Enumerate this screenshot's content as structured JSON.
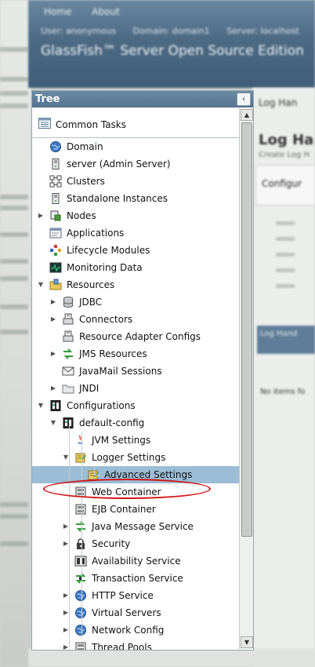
{
  "background": {
    "menu": [
      "Home",
      "About"
    ],
    "user_info": [
      "User: anonymous",
      "Domain: domain1",
      "Server: localhost"
    ],
    "brand": "GlassFish™ Server Open Source Edition",
    "right_tab": "Log Han",
    "right_heading": "Log Han",
    "right_sub": "Create Log H",
    "right_box_label": "Configur",
    "right_bar": "Log Hand",
    "right_no_items": "No items fo"
  },
  "tree": {
    "title": "Tree",
    "collapse_glyph": "‹",
    "common_tasks": "Common Tasks",
    "nodes": [
      {
        "label": "Domain",
        "icon": "globe-icon"
      },
      {
        "label": "server (Admin Server)",
        "icon": "server-icon"
      },
      {
        "label": "Clusters",
        "icon": "clusters-icon"
      },
      {
        "label": "Standalone Instances",
        "icon": "server-icon"
      },
      {
        "label": "Nodes",
        "icon": "nodes-icon"
      },
      {
        "label": "Applications",
        "icon": "applications-icon"
      },
      {
        "label": "Lifecycle Modules",
        "icon": "lifecycle-icon"
      },
      {
        "label": "Monitoring Data",
        "icon": "monitoring-icon"
      },
      {
        "label": "Resources",
        "icon": "resources-icon"
      },
      {
        "label": "JDBC",
        "icon": "database-icon"
      },
      {
        "label": "Connectors",
        "icon": "connector-icon"
      },
      {
        "label": "Resource Adapter Configs",
        "icon": "connector-icon"
      },
      {
        "label": "JMS Resources",
        "icon": "jms-icon"
      },
      {
        "label": "JavaMail Sessions",
        "icon": "mail-icon"
      },
      {
        "label": "JNDI",
        "icon": "folder-icon"
      },
      {
        "label": "Configurations",
        "icon": "config-icon"
      },
      {
        "label": "default-config",
        "icon": "config-icon"
      },
      {
        "label": "JVM Settings",
        "icon": "java-icon"
      },
      {
        "label": "Logger Settings",
        "icon": "logger-icon"
      },
      {
        "label": "Advanced Settings",
        "icon": "logger-icon"
      },
      {
        "label": "Web Container",
        "icon": "container-icon"
      },
      {
        "label": "EJB Container",
        "icon": "container-icon"
      },
      {
        "label": "Java Message Service",
        "icon": "jms-icon"
      },
      {
        "label": "Security",
        "icon": "lock-icon"
      },
      {
        "label": "Availability Service",
        "icon": "availability-icon"
      },
      {
        "label": "Transaction Service",
        "icon": "transaction-icon"
      },
      {
        "label": "HTTP Service",
        "icon": "globe-icon"
      },
      {
        "label": "Virtual Servers",
        "icon": "globe-icon"
      },
      {
        "label": "Network Config",
        "icon": "globe-icon"
      },
      {
        "label": "Thread Pools",
        "icon": "container-icon"
      }
    ],
    "selected": "Advanced Settings"
  },
  "colors": {
    "header": "#5f7d98",
    "selected_row": "#9bbdd6",
    "highlight_ellipse": "#d21414"
  }
}
